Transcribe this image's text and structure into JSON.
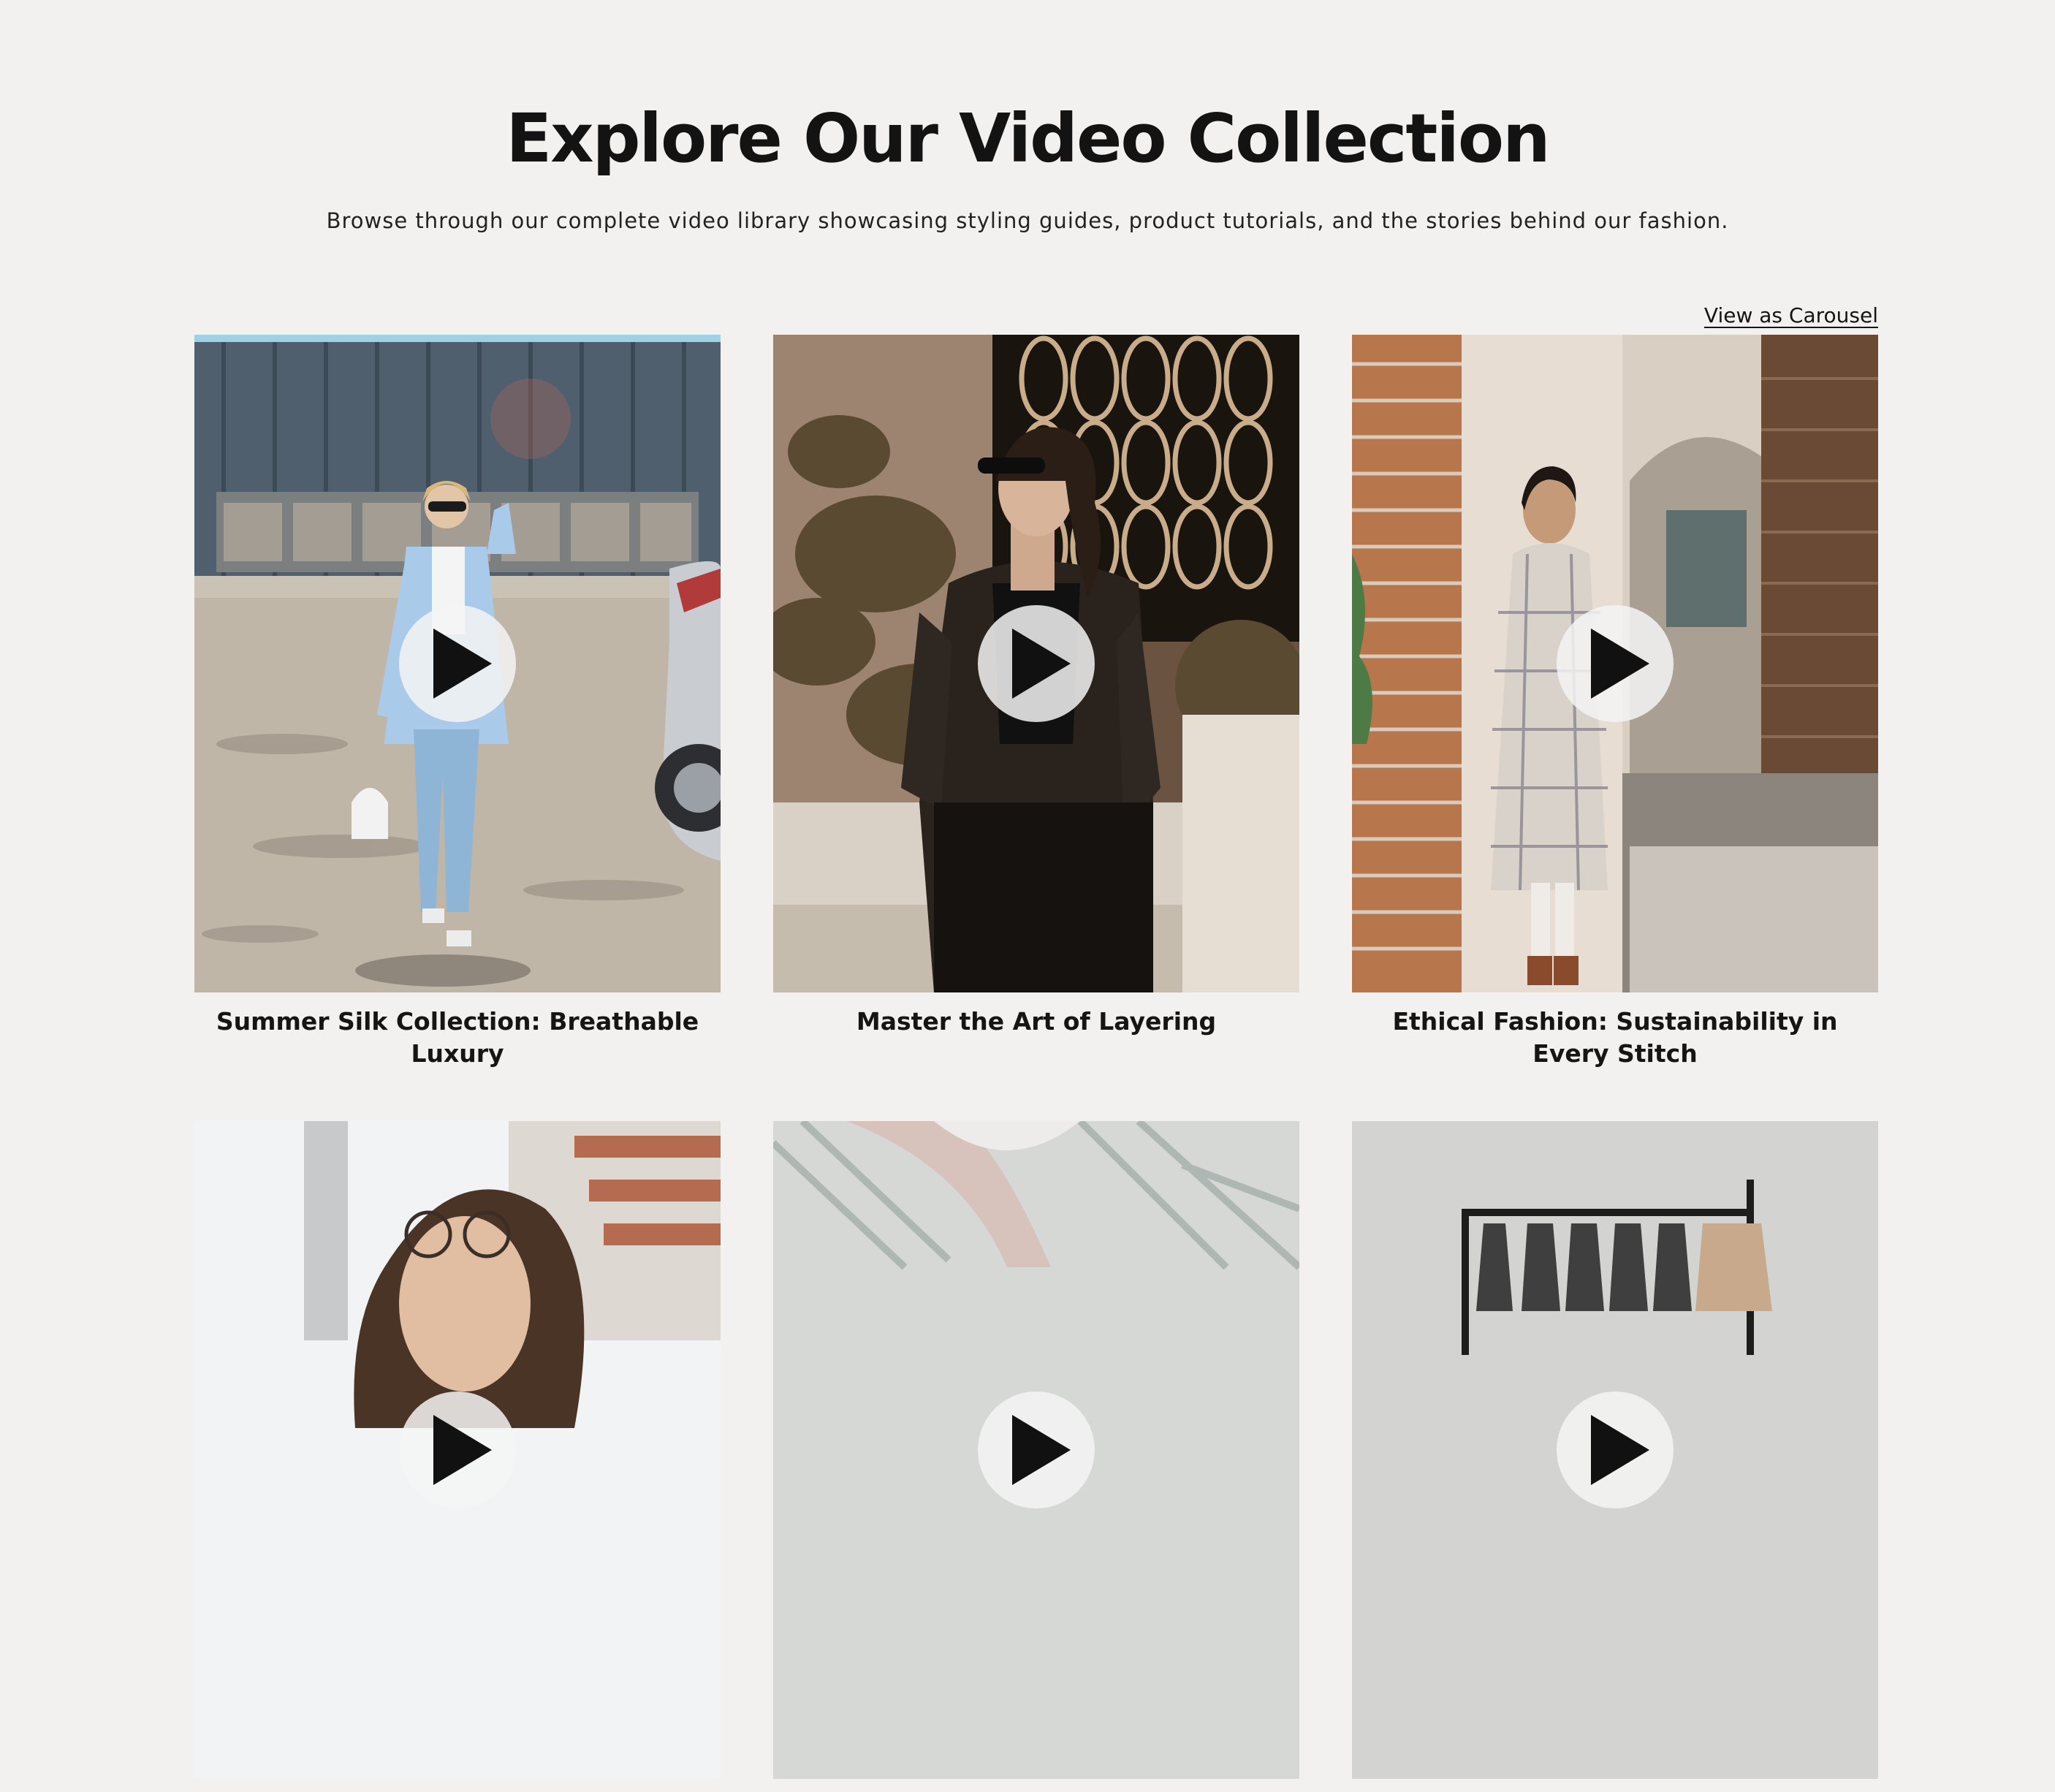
{
  "section": {
    "title": "Explore Our Video Collection",
    "subtitle": "Browse through our complete video library showcasing styling guides, product tutorials, and the stories behind our fashion.",
    "view_toggle_label": "View as Carousel"
  },
  "videos": [
    {
      "title": "Summer Silk Collection: Breathable Luxury",
      "icon": "play-icon"
    },
    {
      "title": "Master the Art of Layering",
      "icon": "play-icon"
    },
    {
      "title": "Ethical Fashion: Sustainability in Every Stitch",
      "icon": "play-icon"
    },
    {
      "title": "",
      "icon": "play-icon"
    },
    {
      "title": "",
      "icon": "play-icon"
    },
    {
      "title": "",
      "icon": "play-icon"
    }
  ],
  "colors": {
    "background": "#f3f1f0",
    "text": "#141414",
    "play_button_bg": "#f5f5f5",
    "play_glyph": "#111111"
  }
}
